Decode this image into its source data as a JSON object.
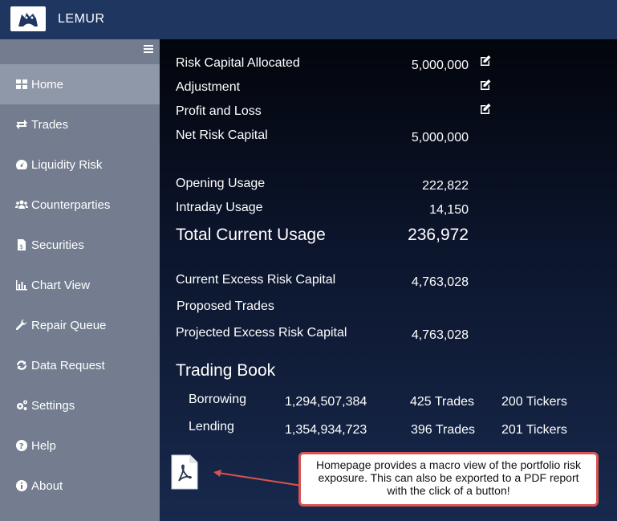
{
  "app": {
    "title": "LEMUR"
  },
  "sidebar": {
    "items": [
      {
        "label": "Home",
        "icon": "home-grid-icon",
        "active": true
      },
      {
        "label": "Trades",
        "icon": "exchange-arrows-icon"
      },
      {
        "label": "Liquidity Risk",
        "icon": "gauge-icon"
      },
      {
        "label": "Counterparties",
        "icon": "users-icon"
      },
      {
        "label": "Securities",
        "icon": "document-dollar-icon"
      },
      {
        "label": "Chart View",
        "icon": "bar-chart-icon"
      },
      {
        "label": "Repair Queue",
        "icon": "wrench-icon"
      },
      {
        "label": "Data Request",
        "icon": "refresh-icon"
      },
      {
        "label": "Settings",
        "icon": "gears-icon"
      },
      {
        "label": "Help",
        "icon": "question-circle-icon"
      },
      {
        "label": "About",
        "icon": "info-circle-icon"
      }
    ]
  },
  "summary": {
    "risk_capital_allocated": {
      "label": "Risk Capital Allocated",
      "value": "5,000,000"
    },
    "adjustment": {
      "label": "Adjustment",
      "value": ""
    },
    "profit_and_loss": {
      "label": "Profit and Loss",
      "value": ""
    },
    "net_risk_capital": {
      "label": "Net Risk Capital",
      "value": "5,000,000"
    },
    "opening_usage": {
      "label": "Opening Usage",
      "value": "222,822"
    },
    "intraday_usage": {
      "label": "Intraday Usage",
      "value": "14,150"
    },
    "total_current_usage": {
      "label": "Total Current Usage",
      "value": "236,972"
    },
    "current_excess": {
      "label": "Current Excess Risk Capital",
      "value": "4,763,028"
    },
    "proposed_trades": {
      "label": "Proposed Trades",
      "value": ""
    },
    "projected_excess": {
      "label": "Projected Excess Risk Capital",
      "value": "4,763,028"
    }
  },
  "trading_book": {
    "title": "Trading Book",
    "rows": [
      {
        "label": "Borrowing",
        "amount": "1,294,507,384",
        "trades": "425 Trades",
        "tickers": "200 Tickers"
      },
      {
        "label": "Lending",
        "amount": "1,354,934,723",
        "trades": "396 Trades",
        "tickers": "201 Tickers"
      }
    ]
  },
  "export": {
    "icon": "pdf-file-icon"
  },
  "annotation": {
    "text": "Homepage provides a macro view of the portfolio risk exposure. This can also be exported to a PDF report with the click of a button!"
  },
  "colors": {
    "topbar": "#1f3661",
    "sidebar": "#737d8f",
    "sidebar_active": "#8f98a8",
    "callout_border": "#d9534f"
  }
}
